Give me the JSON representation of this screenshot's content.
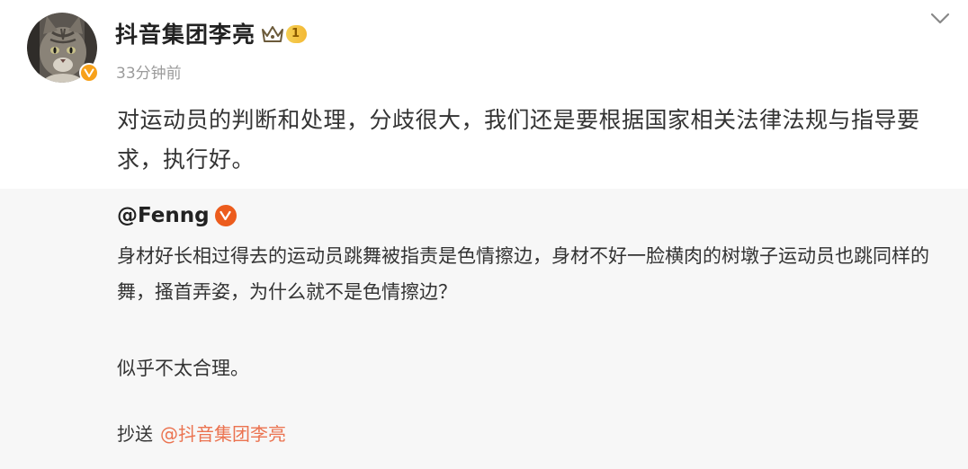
{
  "post": {
    "author": "抖音集团李亮",
    "vip_level": "1",
    "timestamp": "33分钟前",
    "text": "对运动员的判断和处理，分歧很大，我们还是要根据国家相关法律法规与指导要求，执行好。"
  },
  "repost": {
    "author": "@Fenng",
    "text": "身材好长相过得去的运动员跳舞被指责是色情擦边，身材不好一脸横肉的树墩子运动员也跳同样的舞，搔首弄姿，为什么就不是色情擦边？",
    "text2": "似乎不太合理。",
    "cc_label": "抄送",
    "cc_mention": "@抖音集团李亮"
  },
  "icons": {
    "avatar": "cat-avatar",
    "verified": "verified-v-icon",
    "vip": "crown-icon",
    "menu": "chevron-down-icon"
  },
  "colors": {
    "mention": "#eb7350",
    "verified_orange": "#f7a11a",
    "repost_bg": "#f7f7f7",
    "timestamp": "#9b9b9b"
  }
}
